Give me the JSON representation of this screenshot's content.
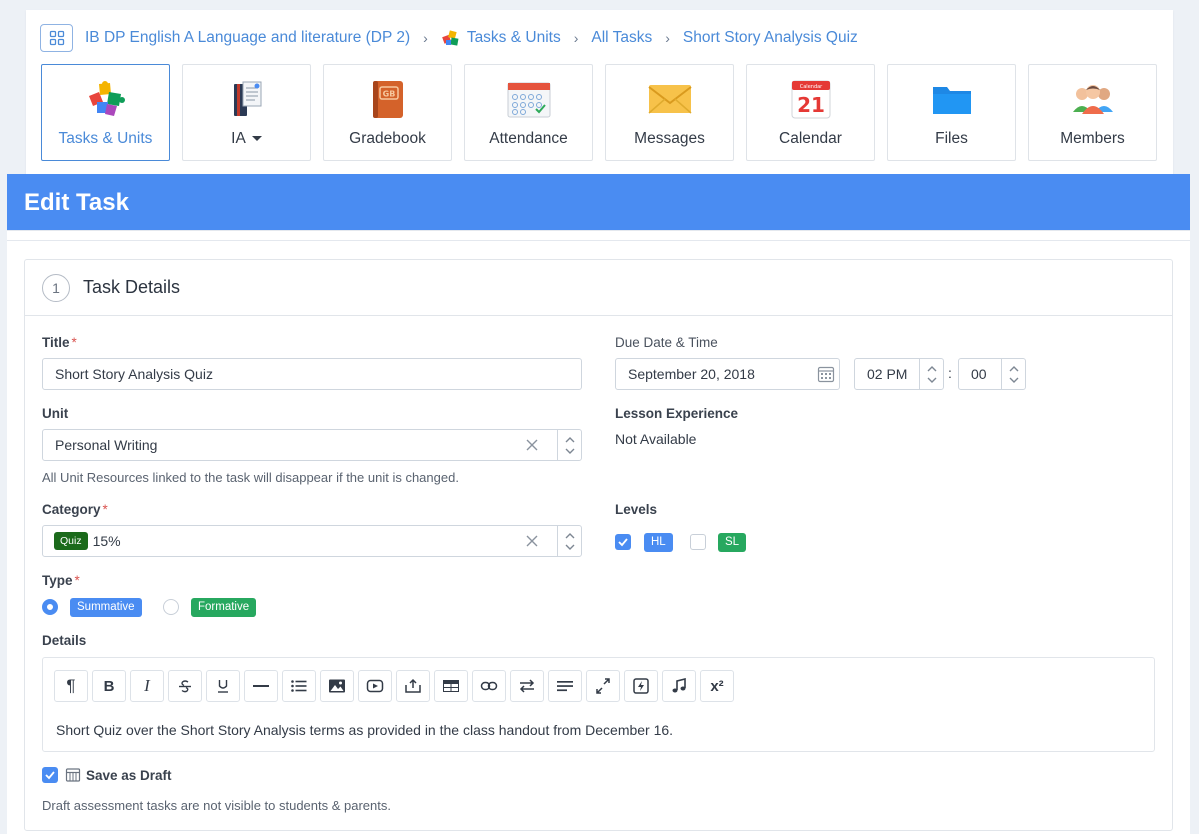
{
  "breadcrumb": {
    "course": "IB DP English A Language and literature (DP 2)",
    "section": "Tasks & Units",
    "list": "All Tasks",
    "current": "Short Story Analysis Quiz"
  },
  "tiles": [
    {
      "label": "Tasks & Units",
      "icon": "puzzle-icon",
      "active": true
    },
    {
      "label": "IA",
      "icon": "ia-book-icon",
      "dropdown": true
    },
    {
      "label": "Gradebook",
      "icon": "gradebook-icon"
    },
    {
      "label": "Attendance",
      "icon": "attendance-icon"
    },
    {
      "label": "Messages",
      "icon": "envelope-icon"
    },
    {
      "label": "Calendar",
      "icon": "calendar-icon",
      "calendar_day": "21",
      "calendar_header": "Calendar"
    },
    {
      "label": "Files",
      "icon": "folder-icon"
    },
    {
      "label": "Members",
      "icon": "members-icon"
    }
  ],
  "header": {
    "title": "Edit Task"
  },
  "section": {
    "number": "1",
    "title": "Task Details"
  },
  "form": {
    "title_label": "Title",
    "title_value": "Short Story Analysis Quiz",
    "due_label": "Due Date & Time",
    "due_date": "September 20, 2018",
    "due_hour": "02 PM",
    "due_minute": "00",
    "time_separator": ":",
    "unit_label": "Unit",
    "unit_value": "Personal Writing",
    "unit_help": "All Unit Resources linked to the task will disappear if the unit is changed.",
    "lesson_label": "Lesson Experience",
    "lesson_value": "Not Available",
    "category_label": "Category",
    "category_badge": "Quiz",
    "category_value": "15%",
    "levels_label": "Levels",
    "levels": [
      {
        "label": "HL",
        "checked": true,
        "color": "#4a8cf2"
      },
      {
        "label": "SL",
        "checked": false,
        "color": "#27a85f"
      }
    ],
    "type_label": "Type",
    "types": [
      {
        "label": "Summative",
        "selected": true,
        "color": "#4a8cf2"
      },
      {
        "label": "Formative",
        "selected": false,
        "color": "#27a85f"
      }
    ],
    "details_label": "Details",
    "details_text": "Short Quiz over the Short Story Analysis terms as provided in the class handout from December 16.",
    "draft_label": "Save as Draft",
    "draft_checked": true,
    "draft_help": "Draft assessment tasks are not visible to students & parents."
  },
  "toolbar": [
    "paragraph-icon",
    "bold-icon",
    "italic-icon",
    "strikethrough-icon",
    "underline-icon",
    "horizontal-rule-icon",
    "list-icon",
    "image-icon",
    "video-icon",
    "upload-icon",
    "table-icon",
    "link-icon",
    "text-direction-icon",
    "align-icon",
    "fullscreen-icon",
    "flash-icon",
    "audio-icon",
    "superscript-icon"
  ],
  "toolbar_text": {
    "bold": "B",
    "italic": "I",
    "superscript": "x²",
    "paragraph": "¶"
  },
  "colors": {
    "accent": "#4a8cf2",
    "green": "#27a85f",
    "quiz_badge": "#1b6a1b",
    "required": "#d9534f"
  }
}
